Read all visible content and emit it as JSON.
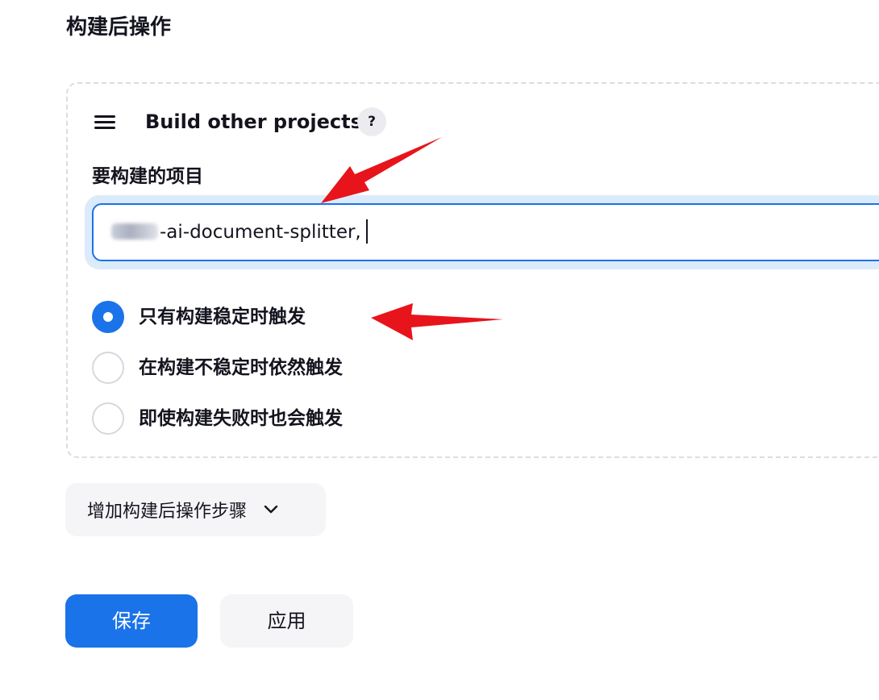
{
  "section": {
    "title": "构建后操作"
  },
  "step": {
    "title": "Build other projects",
    "help_label": "?",
    "projects_label": "要构建的项目",
    "projects_value": "-ai-document-splitter,",
    "trigger_options": [
      {
        "label": "只有构建稳定时触发",
        "checked": true
      },
      {
        "label": "在构建不稳定时依然触发",
        "checked": false
      },
      {
        "label": "即使构建失败时也会触发",
        "checked": false
      }
    ]
  },
  "actions": {
    "add_step_label": "增加构建后操作步骤",
    "save_label": "保存",
    "apply_label": "应用"
  },
  "colors": {
    "accent": "#1a73e8",
    "annotation_arrow": "#e8141b"
  },
  "icons": {
    "drag_handle": "hamburger-icon",
    "dropdown": "chevron-down-icon"
  }
}
